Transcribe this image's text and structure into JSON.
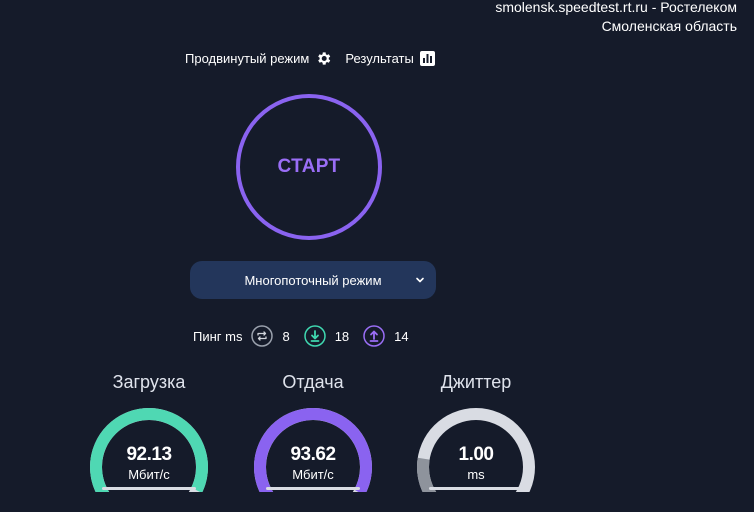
{
  "server": {
    "host": "smolensk.speedtest.rt.ru - Ростелеком",
    "region": "Смоленская область"
  },
  "nav": {
    "advanced_label": "Продвинутый режим",
    "advanced_icon": "gear-icon",
    "results_label": "Результаты",
    "results_icon": "bar-chart-icon"
  },
  "start": {
    "label": "СТАРТ",
    "color": "#8a63f0"
  },
  "mode": {
    "selected": "Многопоточный режим",
    "icon": "chevron-down-icon"
  },
  "ping": {
    "label": "Пинг ms",
    "idle": {
      "icon": "loop-icon",
      "value": "8"
    },
    "download": {
      "icon": "download-icon",
      "value": "18",
      "color": "#3fd8b0"
    },
    "upload": {
      "icon": "upload-icon",
      "value": "14",
      "color": "#9a6ef6"
    }
  },
  "gauges": [
    {
      "title": "Загрузка",
      "value": "92.13",
      "unit": "Мбит/с",
      "fill_fraction": 0.93,
      "color": "#4fd8b3"
    },
    {
      "title": "Отдача",
      "value": "93.62",
      "unit": "Мбит/с",
      "fill_fraction": 0.94,
      "color": "#8a63f0"
    },
    {
      "title": "Джиттер",
      "value": "1.00",
      "unit": "ms",
      "fill_fraction": 0.2,
      "color": "#8e939c"
    }
  ]
}
